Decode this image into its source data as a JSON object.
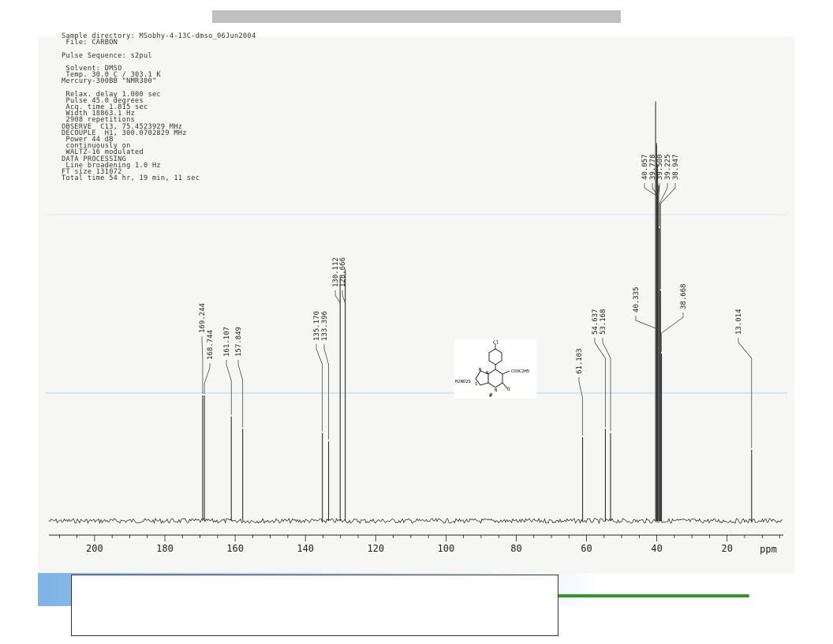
{
  "header_lines": [
    "Sample directory: MSobhy-4-13C-dmso_06Jun2004",
    " File: CARBON",
    "",
    "Pulse Sequence: s2pul",
    "",
    " Solvent: DMSO",
    " Temp. 30.0 C / 303.1 K",
    "Mercury-300BB \"NMR300\"",
    "",
    " Relax. delay 1.000 sec",
    " Pulse 45.0 degrees",
    " Acq. time 1.815 sec",
    " Width 18863.1 Hz",
    " 2908 repetitions",
    "OBSERVE  C13, 75.4523929 MHz",
    "DECOUPLE  H1, 300.0702829 MHz",
    " Power 44 dB",
    " continuously on",
    " WALTZ-16 modulated",
    "DATA PROCESSING",
    " Line broadening 1.0 Hz",
    "FT size 131072",
    "Total time 54 hr, 19 min, 11 sec"
  ],
  "structure": {
    "substituent_top": "Cl",
    "left_group": "H2NO2S",
    "right_group": "COOC2H5",
    "oxo": "O",
    "ring_n1": "N",
    "ring_n2": "N",
    "ring_n3": "N",
    "ring_s": "S",
    "mark": "#"
  },
  "colors": {
    "spectrum": "#1a1a1a",
    "scan_bg": "#f6f6f5",
    "green_line": "#2a9a2a",
    "footer_blue": "#7fb3e6"
  },
  "chart_data": {
    "type": "line",
    "title": "",
    "xlabel": "ppm",
    "ylabel": "",
    "x_reversed": true,
    "xlim": [
      213,
      4
    ],
    "x_ticks": [
      200,
      180,
      160,
      140,
      120,
      100,
      80,
      60,
      40,
      20
    ],
    "x_tick_labels": [
      "200",
      "180",
      "160",
      "140",
      "120",
      "100",
      "80",
      "60",
      "40",
      "20"
    ],
    "peaks": [
      {
        "ppm": 169.244,
        "label": "169.244",
        "intensity": 0.3
      },
      {
        "ppm": 168.744,
        "label": "168.744",
        "intensity": 0.3
      },
      {
        "ppm": 161.107,
        "label": "161.107",
        "intensity": 0.25
      },
      {
        "ppm": 157.849,
        "label": "157.849",
        "intensity": 0.22
      },
      {
        "ppm": 135.17,
        "label": "135.170",
        "intensity": 0.21
      },
      {
        "ppm": 133.396,
        "label": "133.396",
        "intensity": 0.19
      },
      {
        "ppm": 130.112,
        "label": "130.112",
        "intensity": 0.58
      },
      {
        "ppm": 128.666,
        "label": "128.666",
        "intensity": 0.6
      },
      {
        "ppm": 61.103,
        "label": "61.103",
        "intensity": 0.2
      },
      {
        "ppm": 54.637,
        "label": "54.637",
        "intensity": 0.22
      },
      {
        "ppm": 53.168,
        "label": "53.168",
        "intensity": 0.21
      },
      {
        "ppm": 40.335,
        "label": "40.335",
        "intensity": 1.0
      },
      {
        "ppm": 40.057,
        "label": "40.057",
        "intensity": 0.9
      },
      {
        "ppm": 39.778,
        "label": "39.778",
        "intensity": 0.85
      },
      {
        "ppm": 39.5,
        "label": "39.500",
        "intensity": 0.8
      },
      {
        "ppm": 39.225,
        "label": "39.225",
        "intensity": 0.7
      },
      {
        "ppm": 38.947,
        "label": "38.947",
        "intensity": 0.55
      },
      {
        "ppm": 38.668,
        "label": "38.668",
        "intensity": 0.4
      },
      {
        "ppm": 13.014,
        "label": "13.014",
        "intensity": 0.17
      }
    ]
  }
}
